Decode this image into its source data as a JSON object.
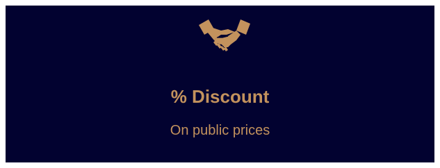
{
  "card": {
    "icon": "handshake-icon",
    "title": "% Discount",
    "subtitle": "On public prices"
  },
  "colors": {
    "background": "#020230",
    "accent": "#c3925d",
    "page": "#ffffff"
  }
}
